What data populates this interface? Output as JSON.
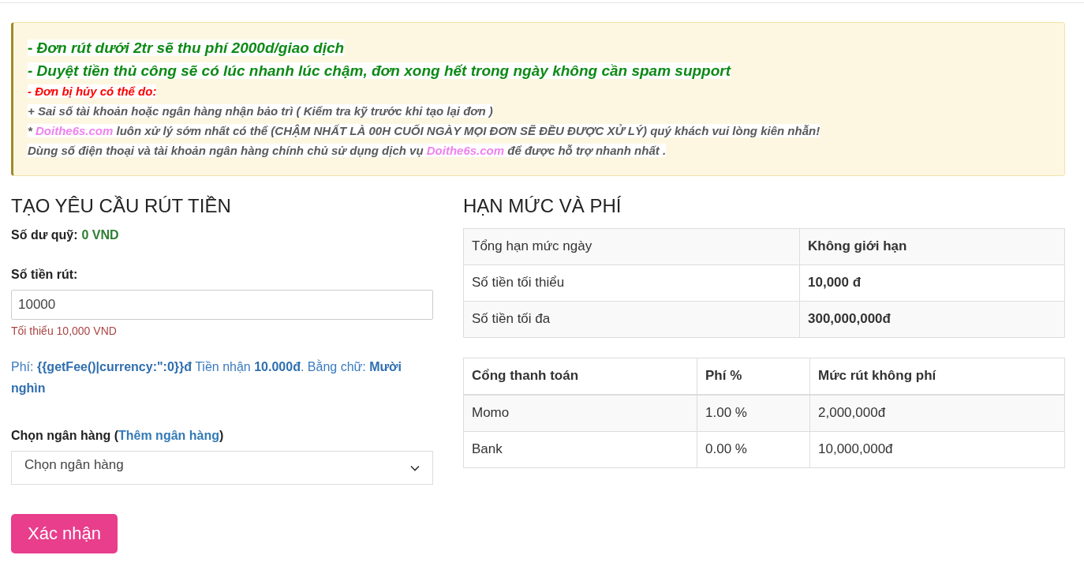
{
  "notice": {
    "lines": [
      {
        "kind": "major",
        "segments": [
          {
            "kind": "plain",
            "text": "- Đơn rút dưới 2tr sẽ thu phí 2000d/giao dịch"
          }
        ]
      },
      {
        "kind": "major",
        "segments": [
          {
            "kind": "plain",
            "text": "- Duyệt tiền thủ công sẽ có lúc nhanh lúc chậm, đơn xong hết trong ngày không cần spam support"
          }
        ]
      },
      {
        "kind": "alert",
        "segments": [
          {
            "kind": "plain",
            "text": "- Đơn bị hủy có thể do:"
          }
        ]
      },
      {
        "kind": "minor",
        "segments": [
          {
            "kind": "plain",
            "text": "+ Sai số tài khoản hoặc ngân hàng nhận bảo trì ( Kiểm tra kỹ trước khi tạo lại đơn )"
          }
        ]
      },
      {
        "kind": "minor",
        "segments": [
          {
            "kind": "plain",
            "text": "* "
          },
          {
            "kind": "link",
            "text": "Doithe6s.com"
          },
          {
            "kind": "plain",
            "text": " luôn xử lý sớm nhất có thể (CHẬM NHẤT LÀ 00H CUỐI NGÀY MỌI ĐƠN SẼ ĐỀU ĐƯỢC XỬ LÝ) quý khách vui lòng kiên nhẫn!"
          }
        ]
      },
      {
        "kind": "minor",
        "segments": [
          {
            "kind": "plain",
            "text": "Dùng số điện thoại và tài khoản ngân hàng chính chủ sử dụng dịch vụ "
          },
          {
            "kind": "link",
            "text": "Doithe6s.com"
          },
          {
            "kind": "plain",
            "text": " để được hỗ trợ nhanh nhất ."
          }
        ]
      }
    ]
  },
  "form": {
    "title": "TẠO YÊU CẦU RÚT TIỀN",
    "balance_label": "Số dư quỹ:",
    "balance_value": "0 VND",
    "amount_label": "Số tiền rút:",
    "amount_value": "10000",
    "amount_hint": "Tối thiểu 10,000 VND",
    "fee_text": "Phí: **{{getFee()|currency:\":0}}đ** Tiền nhận **10.000đ**. Bằng chữ: **Mười nghìn**",
    "bank_label_before": "Chọn ngân hàng (",
    "bank_link": "Thêm ngân hàng",
    "bank_label_after": ")",
    "bank_select": "Chọn ngân hàng",
    "submit": "Xác nhận"
  },
  "limits": {
    "title": "HẠN MỨC VÀ PHÍ",
    "rows": [
      {
        "label": "Tổng hạn mức ngày",
        "value": "Không giới hạn"
      },
      {
        "label": "Số tiền tối thiểu",
        "value": "10,000 đ"
      },
      {
        "label": "Số tiền tối đa",
        "value": "300,000,000đ"
      }
    ],
    "fees": {
      "columns": [
        "Cổng thanh toán",
        "Phí %",
        "Mức rút không phí"
      ],
      "rows": [
        [
          "Momo",
          "1.00 %",
          "2,000,000đ"
        ],
        [
          "Bank",
          "0.00 %",
          "10,000,000đ"
        ]
      ]
    }
  }
}
